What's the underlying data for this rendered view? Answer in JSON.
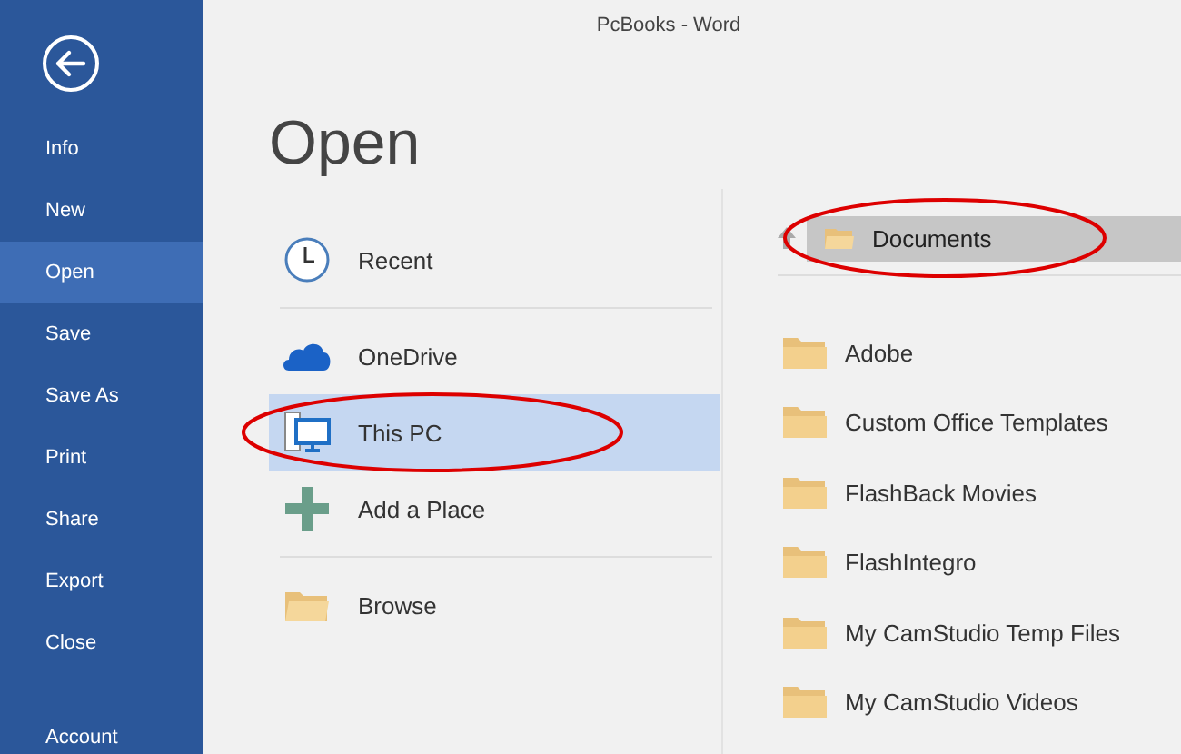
{
  "window": {
    "title": "PcBooks - Word"
  },
  "sidebar": {
    "items": [
      {
        "label": "Info",
        "selected": false
      },
      {
        "label": "New",
        "selected": false
      },
      {
        "label": "Open",
        "selected": true
      },
      {
        "label": "Save",
        "selected": false
      },
      {
        "label": "Save As",
        "selected": false
      },
      {
        "label": "Print",
        "selected": false
      },
      {
        "label": "Share",
        "selected": false
      },
      {
        "label": "Export",
        "selected": false
      },
      {
        "label": "Close",
        "selected": false
      }
    ],
    "footer_items": [
      {
        "label": "Account",
        "selected": false
      }
    ]
  },
  "page_title": "Open",
  "places": [
    {
      "label": "Recent",
      "kind": "recent",
      "selected": false
    },
    {
      "label": "OneDrive",
      "kind": "cloud",
      "selected": false
    },
    {
      "label": "This PC",
      "kind": "pc",
      "selected": true
    },
    {
      "label": "Add a Place",
      "kind": "add",
      "selected": false
    },
    {
      "label": "Browse",
      "kind": "browse",
      "selected": false
    }
  ],
  "breadcrumb": {
    "label": "Documents"
  },
  "folders": [
    {
      "name": "Adobe"
    },
    {
      "name": "Custom Office Templates"
    },
    {
      "name": "FlashBack Movies"
    },
    {
      "name": "FlashIntegro"
    },
    {
      "name": "My CamStudio Temp Files"
    },
    {
      "name": "My CamStudio Videos"
    }
  ]
}
